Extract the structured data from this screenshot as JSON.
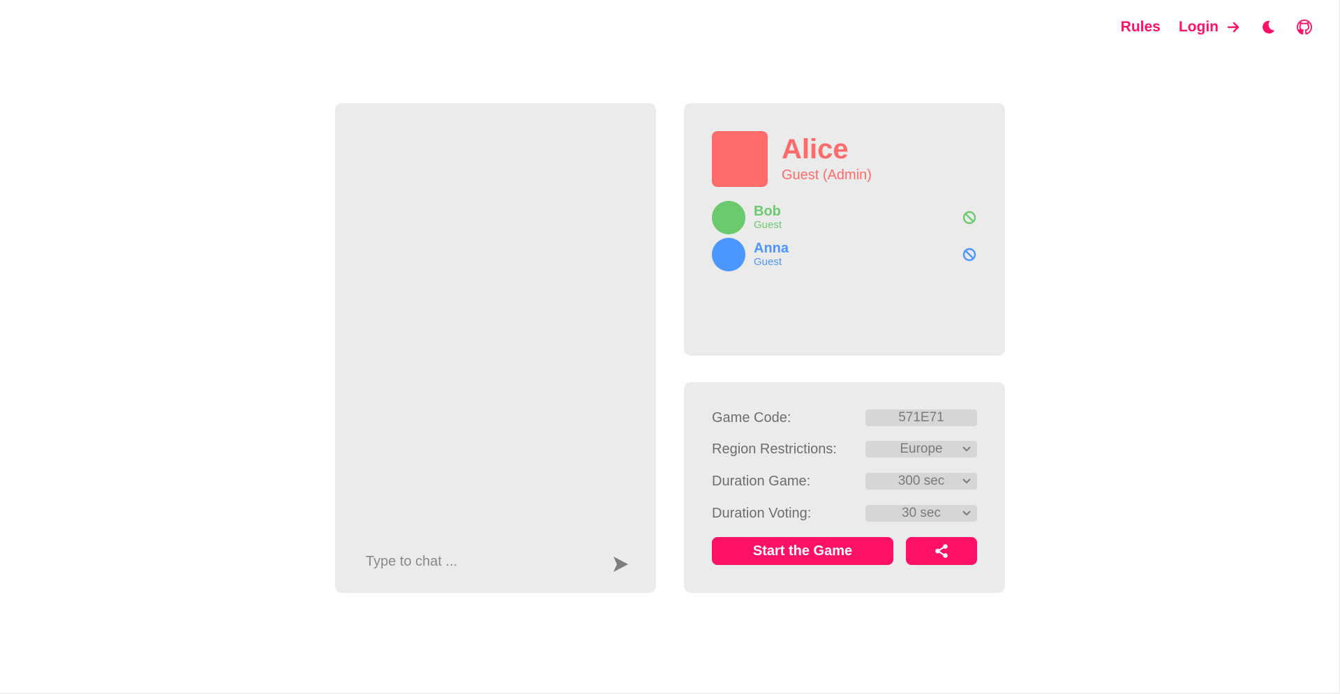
{
  "nav": {
    "rules_label": "Rules",
    "login_label": "Login",
    "icons": [
      "arrow-right-icon",
      "moon-icon",
      "github-icon"
    ],
    "accent": "#ff1168"
  },
  "chat": {
    "placeholder": "Type to chat ..."
  },
  "players": {
    "admin": {
      "name": "Alice",
      "role": "Guest (Admin)",
      "color": "#ff6b6b"
    },
    "list": [
      {
        "name": "Bob",
        "role": "Guest",
        "color": "#6acb6e"
      },
      {
        "name": "Anna",
        "role": "Guest",
        "color": "#4c96ff"
      }
    ]
  },
  "settings": {
    "game_code": {
      "label": "Game Code:",
      "value": "571E71"
    },
    "region": {
      "label": "Region Restrictions:",
      "value": "Europe"
    },
    "duration_game": {
      "label": "Duration Game:",
      "value": "300 sec"
    },
    "duration_voting": {
      "label": "Duration Voting:",
      "value": "30 sec"
    }
  },
  "actions": {
    "start_label": "Start the Game",
    "share_icon": "share-icon"
  }
}
